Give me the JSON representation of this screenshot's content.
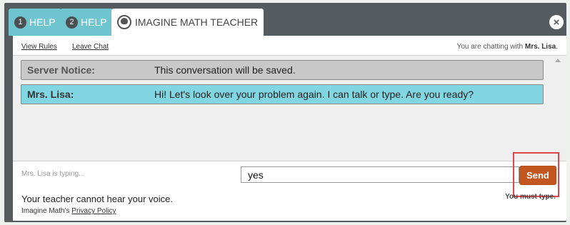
{
  "tabs": [
    {
      "number": "1",
      "label": "HELP"
    },
    {
      "number": "2",
      "label": "HELP"
    },
    {
      "label": "IMAGINE MATH TEACHER"
    }
  ],
  "close_label": "×",
  "links": {
    "view_rules": "View Rules",
    "leave_chat": "Leave Chat"
  },
  "chat_with": {
    "prefix": "You are chatting with",
    "name": "Mrs. Lisa",
    "suffix": "."
  },
  "messages": [
    {
      "sender": "Server Notice:",
      "text": "This conversation will be saved."
    },
    {
      "sender": "Mrs. Lisa:",
      "text": "Hi! Let's look over your problem again. I can talk or type. Are you ready?"
    }
  ],
  "typing_status": "Mrs. Lisa is typing...",
  "input": {
    "value": "yes"
  },
  "send_label": "Send",
  "must_type": "You must type.",
  "voice_notice": "Your teacher cannot hear your voice.",
  "privacy": {
    "prefix": "Imagine Math's",
    "link": "Privacy Policy"
  },
  "colors": {
    "tab_accent": "#6ec4cf",
    "teacher_message_bg": "#82d6e2",
    "server_message_bg": "#c8c8c8",
    "send_button": "#c4571f",
    "highlight_border": "#e0464f"
  }
}
